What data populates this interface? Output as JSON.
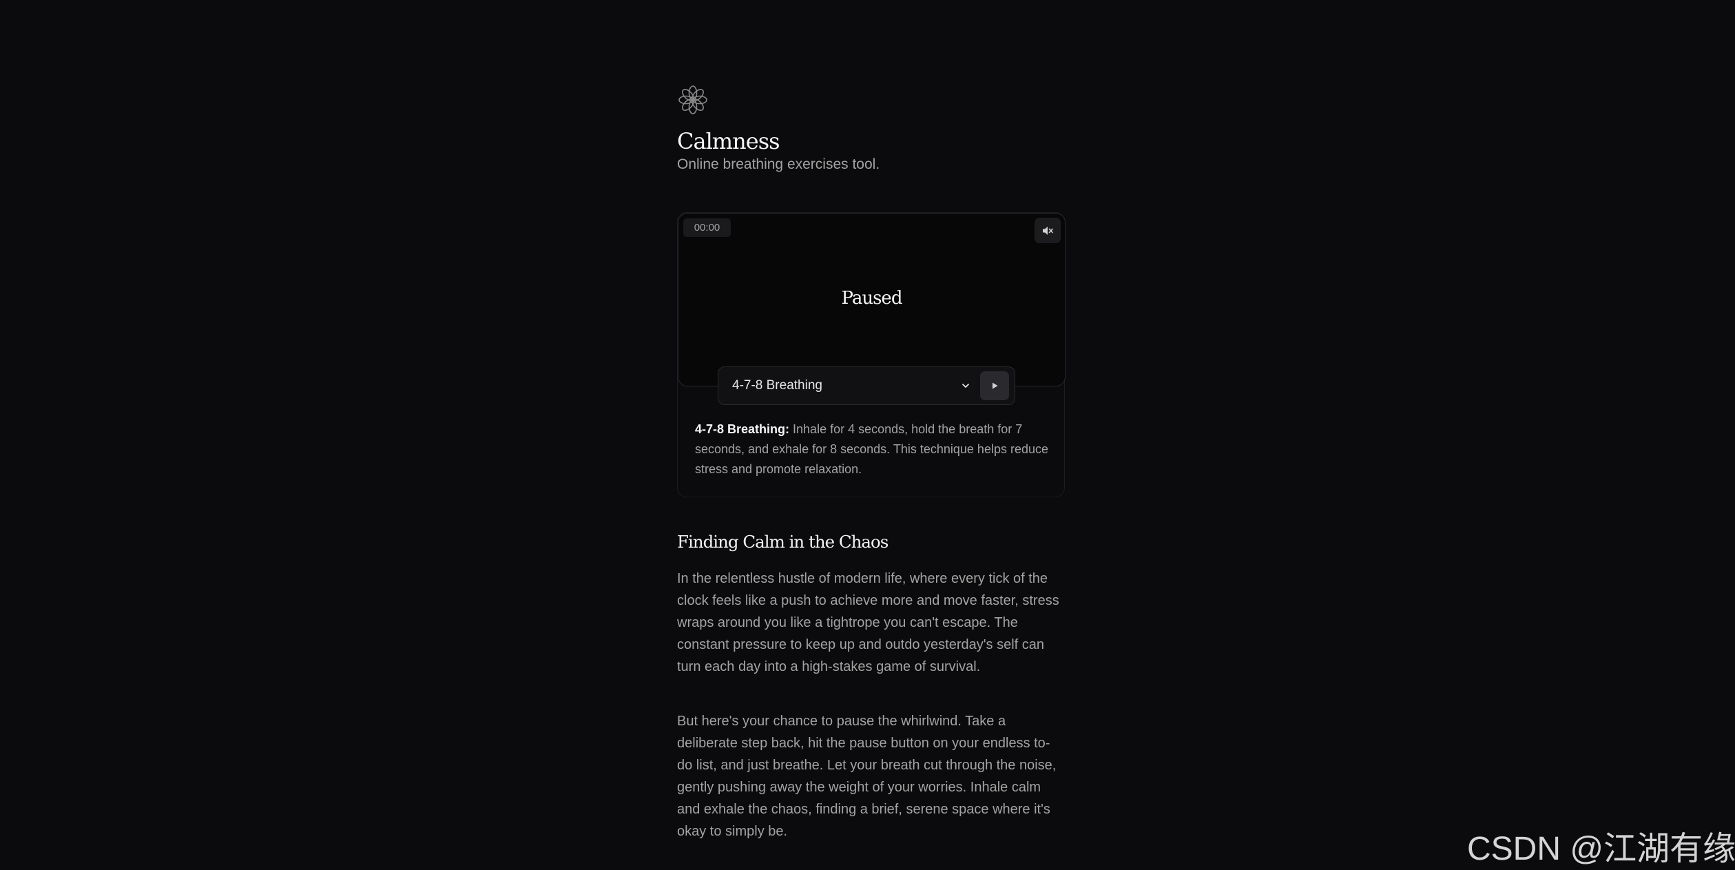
{
  "app": {
    "title": "Calmness",
    "subtitle": "Online breathing exercises tool."
  },
  "player": {
    "timer": "00:00",
    "status": "Paused",
    "exercise_selected": "4-7-8 Breathing",
    "mute_icon": "speaker-mute-icon",
    "play_icon": "play-icon",
    "dropdown_icon": "chevron-down-icon"
  },
  "description": {
    "name": "4-7-8 Breathing:",
    "text": " Inhale for 4 seconds, hold the breath for 7 seconds, and exhale for 8 seconds. This technique helps reduce stress and promote relaxation."
  },
  "article": {
    "heading": "Finding Calm in the Chaos",
    "paragraphs": [
      "In the relentless hustle of modern life, where every tick of the clock feels like a push to achieve more and move faster, stress wraps around you like a tightrope you can't escape. The constant pressure to keep up and outdo yesterday's self can turn each day into a high-stakes game of survival.",
      "But here's your chance to pause the whirlwind. Take a deliberate step back, hit the pause button on your endless to-do list, and just breathe. Let your breath cut through the noise, gently pushing away the weight of your worries. Inhale calm and exhale the chaos, finding a brief, serene space where it's okay to simply be."
    ]
  },
  "watermark": "CSDN @江湖有缘",
  "colors": {
    "background": "#0b0b0d",
    "text_primary": "#f5f5f5",
    "text_secondary": "#a3a3a3"
  }
}
